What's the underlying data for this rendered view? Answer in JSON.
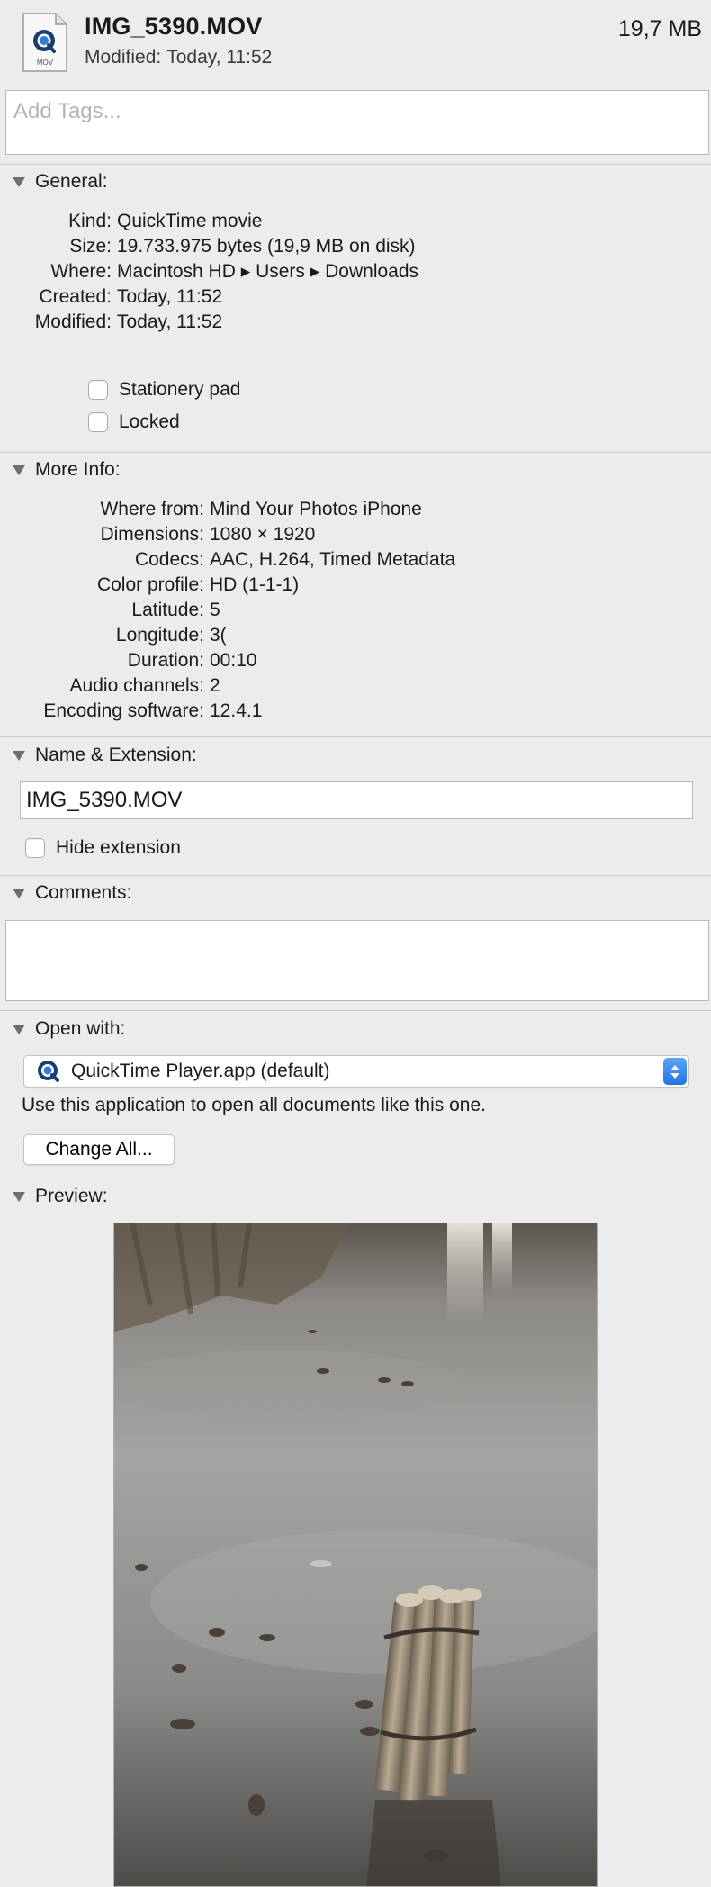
{
  "header": {
    "file_name": "IMG_5390.MOV",
    "file_size": "19,7 MB",
    "modified_label": "Modified:",
    "modified_value": "Today, 11:52",
    "icon_label": "MOV"
  },
  "tags": {
    "placeholder": "Add Tags..."
  },
  "general": {
    "title": "General:",
    "rows": [
      {
        "key": "Kind:",
        "value": "QuickTime movie"
      },
      {
        "key": "Size:",
        "value": "19.733.975 bytes (19,9 MB on disk)"
      },
      {
        "key": "Where:",
        "value": "Macintosh HD ▸ Users ▸ Downloads"
      },
      {
        "key": "Created:",
        "value": "Today, 11:52"
      },
      {
        "key": "Modified:",
        "value": "Today, 11:52"
      }
    ],
    "stationery_label": "Stationery pad",
    "locked_label": "Locked"
  },
  "more_info": {
    "title": "More Info:",
    "rows": [
      {
        "key": "Where from:",
        "value": "Mind Your Photos iPhone"
      },
      {
        "key": "Dimensions:",
        "value": "1080 × 1920"
      },
      {
        "key": "Codecs:",
        "value": "AAC, H.264, Timed Metadata"
      },
      {
        "key": "Color profile:",
        "value": "HD (1-1-1)"
      },
      {
        "key": "Latitude:",
        "value": "5"
      },
      {
        "key": "Longitude:",
        "value": "3("
      },
      {
        "key": "Duration:",
        "value": "00:10"
      },
      {
        "key": "Audio channels:",
        "value": "2"
      },
      {
        "key": "Encoding software:",
        "value": "12.4.1"
      }
    ]
  },
  "name_ext": {
    "title": "Name & Extension:",
    "value": "IMG_5390.MOV",
    "hide_label": "Hide extension"
  },
  "comments": {
    "title": "Comments:"
  },
  "open_with": {
    "title": "Open with:",
    "app": "QuickTime Player.app (default)",
    "description": "Use this application to open all documents like this one.",
    "change_all": "Change All..."
  },
  "preview": {
    "title": "Preview:"
  },
  "colors": {
    "background": "#ececec",
    "accent_blue": "#1f75e6",
    "divider": "#c9c9c9"
  }
}
